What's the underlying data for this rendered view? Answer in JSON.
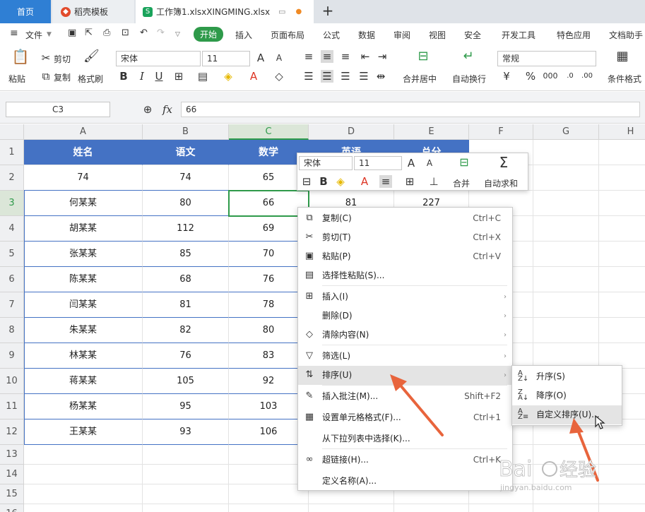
{
  "tabs": {
    "home": "首页",
    "templates": "稻壳模板",
    "doc": "工作簿1.xlsxXINGMING.xlsx",
    "add": "+"
  },
  "menu": {
    "file": "文件",
    "items": [
      "开始",
      "插入",
      "页面布局",
      "公式",
      "数据",
      "审阅",
      "视图",
      "安全",
      "开发工具",
      "特色应用",
      "文档助手"
    ]
  },
  "ribbon": {
    "paste": "粘贴",
    "cut": "剪切",
    "copy": "复制",
    "format_painter": "格式刷",
    "font": "宋体",
    "size": "11",
    "bold": "B",
    "italic": "I",
    "underline": "U",
    "merge": "合并居中",
    "wrap": "自动换行",
    "number_format": "常规",
    "percent": "%",
    "thousands": "000",
    "cond_format": "条件格式"
  },
  "formula": {
    "cell_ref": "C3",
    "fx": "fx",
    "value": "66"
  },
  "columns": [
    "A",
    "B",
    "C",
    "D",
    "E",
    "F",
    "G",
    "H"
  ],
  "rows": [
    "1",
    "2",
    "3",
    "4",
    "5",
    "6",
    "7",
    "8",
    "9",
    "10",
    "11",
    "12",
    "13",
    "14",
    "15",
    "16"
  ],
  "table": {
    "headers": [
      "姓名",
      "语文",
      "数学",
      "英语",
      "总分"
    ],
    "data": [
      [
        "74",
        "74",
        "65",
        "",
        ""
      ],
      [
        "何某某",
        "80",
        "66",
        "81",
        "227"
      ],
      [
        "胡某某",
        "112",
        "69",
        "",
        ""
      ],
      [
        "张某某",
        "85",
        "70",
        "",
        ""
      ],
      [
        "陈某某",
        "68",
        "76",
        "",
        ""
      ],
      [
        "闫某某",
        "81",
        "78",
        "",
        ""
      ],
      [
        "朱某某",
        "82",
        "80",
        "",
        ""
      ],
      [
        "林某某",
        "76",
        "83",
        "",
        ""
      ],
      [
        "蒋某某",
        "105",
        "92",
        "",
        ""
      ],
      [
        "杨某某",
        "95",
        "103",
        "",
        ""
      ],
      [
        "王某某",
        "93",
        "106",
        "",
        ""
      ]
    ]
  },
  "mini_toolbar": {
    "font": "宋体",
    "size": "11",
    "bold": "B",
    "merge": "合并",
    "autosum": "自动求和"
  },
  "context_menu": [
    {
      "label": "复制(C)",
      "shortcut": "Ctrl+C",
      "icon": "copy-icon"
    },
    {
      "label": "剪切(T)",
      "shortcut": "Ctrl+X",
      "icon": "cut-icon"
    },
    {
      "label": "粘贴(P)",
      "shortcut": "Ctrl+V",
      "icon": "paste-icon"
    },
    {
      "label": "选择性粘贴(S)...",
      "shortcut": "",
      "icon": "paste-special-icon"
    },
    {
      "label": "插入(I)",
      "shortcut": "",
      "icon": "insert-icon",
      "submenu": true
    },
    {
      "label": "删除(D)",
      "shortcut": "",
      "icon": "",
      "submenu": true
    },
    {
      "label": "清除内容(N)",
      "shortcut": "",
      "icon": "clear-icon",
      "submenu": true
    },
    {
      "label": "筛选(L)",
      "shortcut": "",
      "icon": "filter-icon",
      "submenu": true
    },
    {
      "label": "排序(U)",
      "shortcut": "",
      "icon": "sort-icon",
      "submenu": true,
      "highlight": true
    },
    {
      "label": "插入批注(M)...",
      "shortcut": "Shift+F2",
      "icon": "comment-icon"
    },
    {
      "label": "设置单元格格式(F)...",
      "shortcut": "Ctrl+1",
      "icon": "format-cells-icon"
    },
    {
      "label": "从下拉列表中选择(K)...",
      "shortcut": "",
      "icon": ""
    },
    {
      "label": "超链接(H)...",
      "shortcut": "Ctrl+K",
      "icon": "link-icon"
    },
    {
      "label": "定义名称(A)...",
      "shortcut": "",
      "icon": ""
    }
  ],
  "sort_submenu": [
    "升序(S)",
    "降序(O)",
    "自定义排序(U)..."
  ],
  "colors": {
    "accent": "#4472c4",
    "selection": "#2e9a4a",
    "tab_active": "#2f7fd4",
    "arrow": "#e8643c"
  }
}
